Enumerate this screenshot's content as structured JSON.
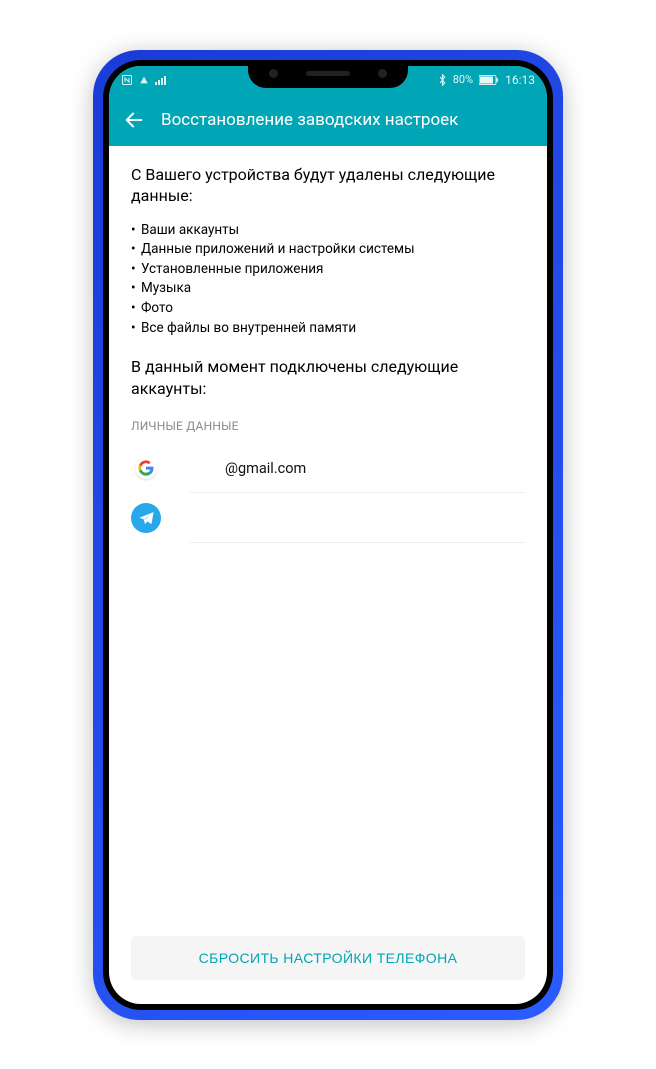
{
  "statusbar": {
    "battery_percent": "80%",
    "time": "16:13"
  },
  "titlebar": {
    "title": "Восстановление заводских настроек"
  },
  "content": {
    "heading": "С Вашего устройства будут удалены следующие данные:",
    "bullets": [
      "Ваши аккаунты",
      "Данные приложений и настройки системы",
      "Установленные приложения",
      "Музыка",
      "Фото",
      "Все файлы во внутренней памяти"
    ],
    "subheading": "В данный момент подключены следующие аккаунты:",
    "personal_section_label": "ЛИЧНЫЕ ДАННЫЕ",
    "accounts": [
      {
        "provider": "google",
        "label": "@gmail.com"
      },
      {
        "provider": "telegram",
        "label": ""
      }
    ]
  },
  "action": {
    "reset_label": "СБРОСИТЬ НАСТРОЙКИ ТЕЛЕФОНА"
  }
}
